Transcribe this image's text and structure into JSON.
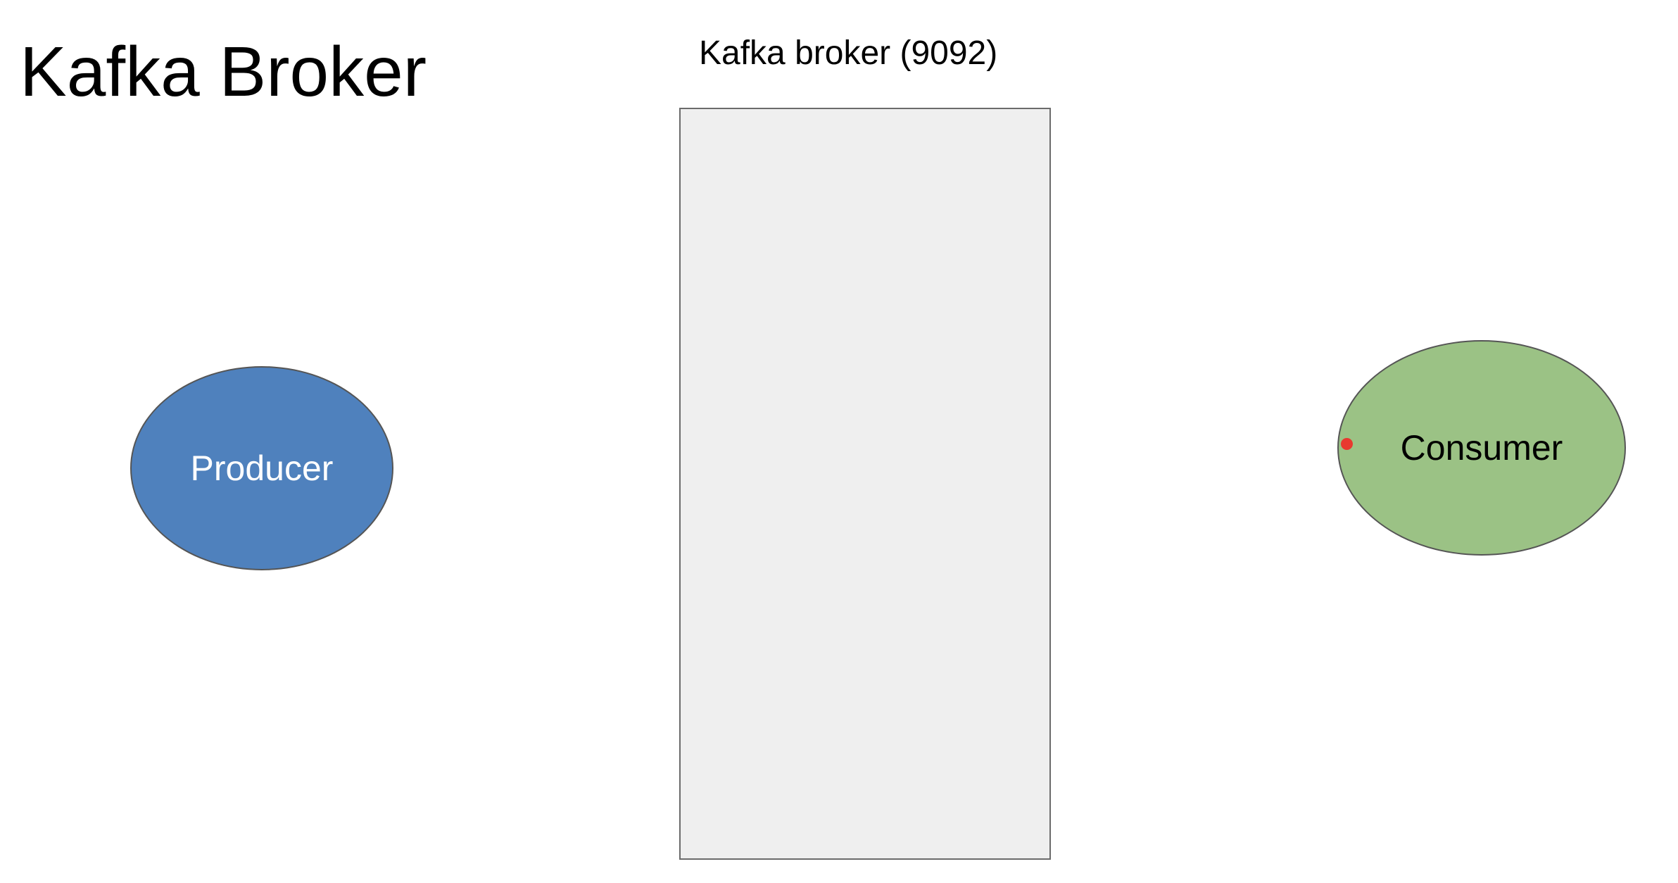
{
  "slide": {
    "title": "Kafka Broker"
  },
  "broker": {
    "label": "Kafka broker (9092)"
  },
  "producer": {
    "label": "Producer",
    "color": "#4f81bd"
  },
  "consumer": {
    "label": "Consumer",
    "color": "#9bc285"
  },
  "pointer": {
    "color": "#e8392f"
  }
}
